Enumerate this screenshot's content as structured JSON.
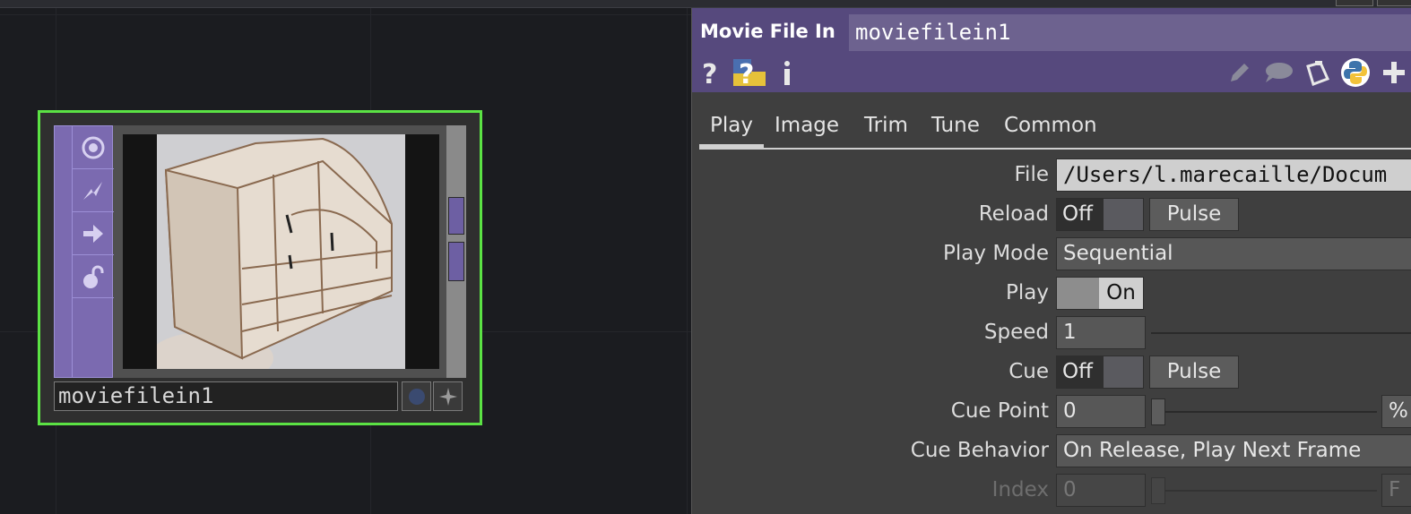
{
  "network": {
    "node": {
      "name": "moviefilein1"
    }
  },
  "panel": {
    "op_type": "Movie File In",
    "op_name": "moviefilein1",
    "header_icons": [
      "help-icon",
      "python-help-icon",
      "info-icon",
      "edit-icon",
      "comment-icon",
      "clipboard-icon",
      "python-icon",
      "add-icon"
    ],
    "tabs": [
      "Play",
      "Image",
      "Trim",
      "Tune",
      "Common"
    ],
    "active_tab": "Play",
    "params": {
      "file": {
        "label": "File",
        "value": "/Users/l.marecaille/Docum"
      },
      "reload": {
        "label": "Reload",
        "toggle": "Off",
        "button": "Pulse"
      },
      "play_mode": {
        "label": "Play Mode",
        "value": "Sequential"
      },
      "play": {
        "label": "Play",
        "toggle": "On"
      },
      "speed": {
        "label": "Speed",
        "value": "1"
      },
      "cue": {
        "label": "Cue",
        "toggle": "Off",
        "button": "Pulse"
      },
      "cue_point": {
        "label": "Cue Point",
        "value": "0",
        "unit": "%"
      },
      "cue_behavior": {
        "label": "Cue Behavior",
        "value": "On Release, Play Next Frame"
      },
      "index": {
        "label": "Index",
        "value": "0",
        "unit": "F"
      }
    }
  }
}
